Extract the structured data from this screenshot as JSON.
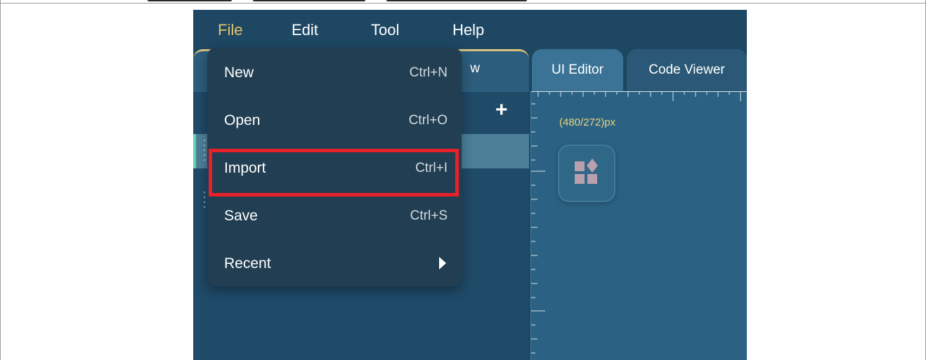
{
  "menubar": {
    "items": [
      {
        "label": "File"
      },
      {
        "label": "Edit"
      },
      {
        "label": "Tool"
      },
      {
        "label": "Help"
      }
    ]
  },
  "tabs": {
    "left_partial_label": "w",
    "ui_editor": "UI Editor",
    "code_viewer": "Code Viewer"
  },
  "canvas": {
    "resolution_text": "(480/272)px"
  },
  "file_menu": {
    "items": [
      {
        "label": "New",
        "shortcut": "Ctrl+N"
      },
      {
        "label": "Open",
        "shortcut": "Ctrl+O"
      },
      {
        "label": "Import",
        "shortcut": "Ctrl+I"
      },
      {
        "label": "Save",
        "shortcut": "Ctrl+S"
      },
      {
        "label": "Recent",
        "shortcut": ""
      }
    ]
  },
  "colors": {
    "active_menu": "#e3c56a",
    "highlight_box": "#e8202a",
    "selection_accent": "#5fd3b0",
    "coord_text": "#e8d47a"
  }
}
